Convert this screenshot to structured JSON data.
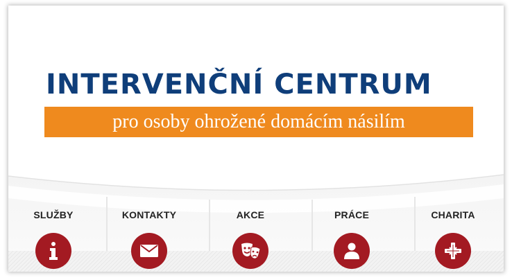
{
  "header": {
    "title": "INTERVENČNÍ CENTRUM",
    "subtitle": "pro osoby ohrožené domácím násilím"
  },
  "nav": {
    "items": [
      {
        "label": "SLUŽBY",
        "icon": "info-icon"
      },
      {
        "label": "KONTAKTY",
        "icon": "envelope-icon"
      },
      {
        "label": "AKCE",
        "icon": "theater-masks-icon"
      },
      {
        "label": "PRÁCE",
        "icon": "person-icon"
      },
      {
        "label": "CHARITA",
        "icon": "charity-cross-icon"
      }
    ]
  },
  "colors": {
    "title_blue": "#0f3e7a",
    "subtitle_orange": "#ef8a1e",
    "icon_red": "#a31a22"
  }
}
